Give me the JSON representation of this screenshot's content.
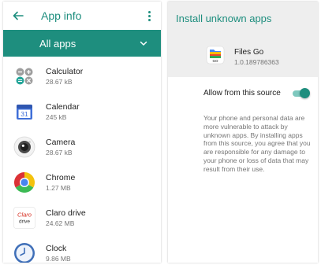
{
  "left_panel": {
    "title": "App info",
    "filter": {
      "label": "All apps"
    },
    "apps": [
      {
        "name": "Calculator",
        "size": "28.67 kB",
        "icon": "calculator-icon"
      },
      {
        "name": "Calendar",
        "size": "245 kB",
        "icon": "calendar-icon",
        "icon_text": "31"
      },
      {
        "name": "Camera",
        "size": "28.67 kB",
        "icon": "camera-icon"
      },
      {
        "name": "Chrome",
        "size": "1.27 MB",
        "icon": "chrome-icon"
      },
      {
        "name": "Claro drive",
        "size": "24.62 MB",
        "icon": "claro-drive-icon",
        "icon_text_1": "Claro",
        "icon_text_2": "drive"
      },
      {
        "name": "Clock",
        "size": "9.86 MB",
        "icon": "clock-icon"
      }
    ]
  },
  "right_panel": {
    "title": "Install unknown apps",
    "app": {
      "name": "Files Go",
      "version": "1.0.189786363",
      "icon": "files-go-icon",
      "icon_text": "GO"
    },
    "toggle": {
      "label": "Allow from this source",
      "enabled": true
    },
    "description": "Your phone and personal data are more vulnerable to attack by unknown apps. By installing apps from this source, you agree that you are responsible for any damage to your phone or loss of data that may result from their use."
  },
  "colors": {
    "accent": "#1e8e7e",
    "switch_track": "#7ec8be",
    "header_bg": "#eeeeee"
  }
}
